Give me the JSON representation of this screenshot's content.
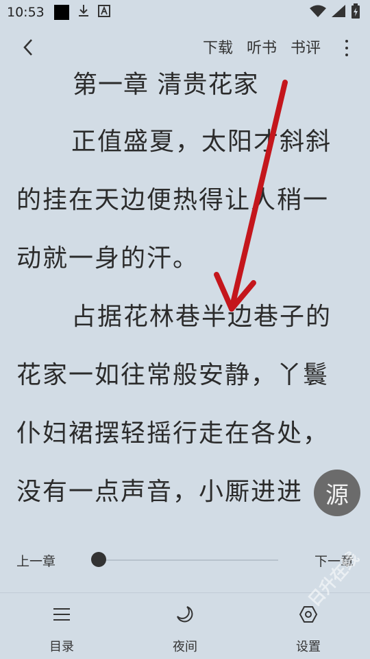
{
  "status_bar": {
    "time": "10:53",
    "left_icons": [
      "black-square-icon",
      "download-icon",
      "a-badge-icon"
    ],
    "right_icons": [
      "wifi-icon",
      "signal-icon",
      "battery-icon"
    ]
  },
  "toolbar": {
    "back_icon": "chevron-left-icon",
    "actions": [
      "下载",
      "听书",
      "书评"
    ],
    "more_icon": "more-vertical-icon"
  },
  "content": {
    "chapter_title": "第一章 清贵花家",
    "lines": [
      "正值盛夏，太阳才斜斜",
      "的挂在天边便热得让人稍一",
      "动就一身的汗。",
      "占据花林巷半边巷子的",
      "花家一如往常般安静，丫鬟",
      "仆妇裙摆轻摇行走在各处，",
      "没有一点声音，小厮进进"
    ]
  },
  "source_button": {
    "label": "源"
  },
  "chapter_nav": {
    "prev": "上一章",
    "next": "下一章",
    "progress": 0.0
  },
  "bottom_tabs": [
    {
      "label": "目录",
      "icon": "menu-icon"
    },
    {
      "label": "夜间",
      "icon": "moon-icon"
    },
    {
      "label": "设置",
      "icon": "settings-icon"
    }
  ],
  "watermark": "日升在线",
  "colors": {
    "background": "#d2dce5",
    "text": "#2b2b2b",
    "arrow": "#c4161c",
    "source_button": "#6b6b6b"
  }
}
